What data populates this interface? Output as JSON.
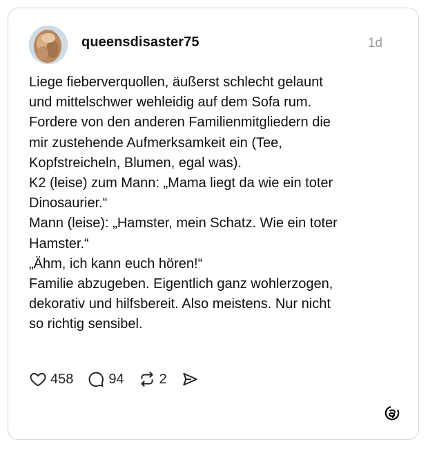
{
  "post": {
    "username": "queensdisaster75",
    "timestamp": "1d",
    "text_lines": [
      "Liege fieberverquollen, äußerst schlecht gelaunt",
      "und mittelschwer wehleidig auf dem Sofa rum.",
      "Fordere von den anderen Familienmitgliedern die",
      "mir zustehende Aufmerksamkeit ein (Tee,",
      "Kopfstreicheln, Blumen, egal was).",
      "K2 (leise) zum Mann: „Mama liegt da wie ein toter",
      "Dinosaurier.“",
      "Mann (leise): „Hamster, mein Schatz. Wie ein toter",
      "Hamster.“",
      "„Ähm, ich kann euch hören!“",
      "Familie abzugeben. Eigentlich ganz wohlerzogen,",
      "dekorativ und hilfsbereit. Also meistens. Nur nicht",
      "so richtig sensibel."
    ],
    "actions": {
      "likes": "458",
      "replies": "94",
      "reposts": "2"
    },
    "icons": {
      "like": "heart-icon",
      "reply": "comment-icon",
      "repost": "repost-icon",
      "share": "send-icon",
      "brand": "threads-logo-icon"
    }
  }
}
